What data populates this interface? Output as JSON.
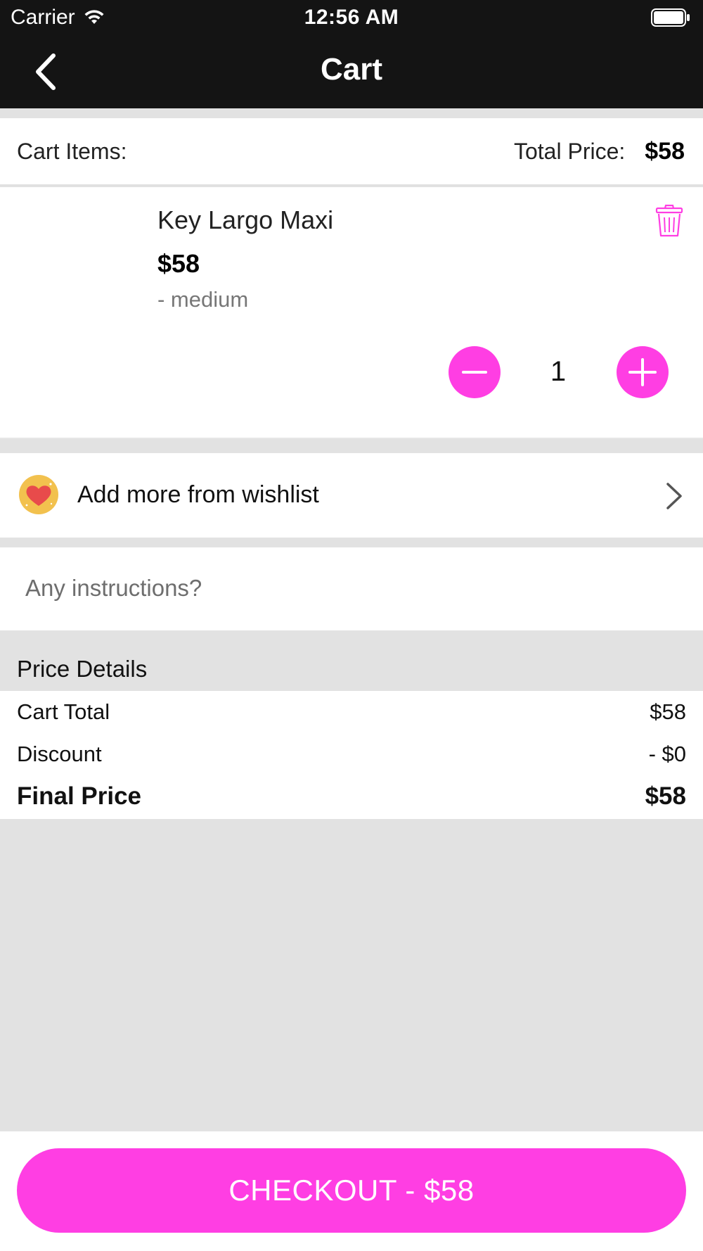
{
  "status_bar": {
    "carrier": "Carrier",
    "time": "12:56 AM"
  },
  "nav": {
    "title": "Cart",
    "back_icon": "chevron-left-icon"
  },
  "cart_header": {
    "items_label": "Cart Items:",
    "total_label": "Total Price:",
    "total_value": "$58"
  },
  "cart_items": [
    {
      "name": "Key Largo Maxi",
      "price": "$58",
      "variant": "- medium",
      "quantity": "1",
      "delete_icon": "trash-icon"
    }
  ],
  "wishlist": {
    "label": "Add more from wishlist",
    "icon": "heart-icon"
  },
  "instructions": {
    "placeholder": "Any instructions?",
    "value": ""
  },
  "price_details": {
    "heading": "Price Details",
    "rows": [
      {
        "label": "Cart Total",
        "value": "$58"
      },
      {
        "label": "Discount",
        "value": "- $0"
      },
      {
        "label": "Final Price",
        "value": "$58"
      }
    ]
  },
  "checkout": {
    "label": "CHECKOUT - $58"
  },
  "colors": {
    "accent": "#ff3ee3",
    "nav_bg": "#141414",
    "page_bg": "#e2e2e2",
    "wishlist_badge": "#f2c14e",
    "heart": "#e84b4b"
  }
}
